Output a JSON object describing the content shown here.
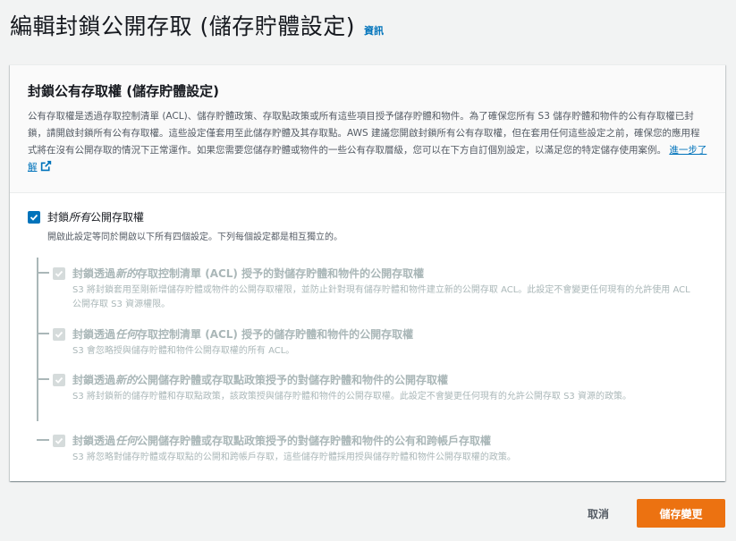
{
  "page": {
    "title": "編輯封鎖公開存取 (儲存貯體設定)",
    "info_link": "資訊"
  },
  "panel": {
    "title": "封鎖公有存取權 (儲存貯體設定)",
    "description": "公有存取權是透過存取控制清單 (ACL)、儲存貯體政策、存取點政策或所有這些項目授予儲存貯體和物件。為了確保您所有 S3 儲存貯體和物件的公有存取權已封鎖，請開啟封鎖所有公有存取權。這些設定僅套用至此儲存貯體及其存取點。AWS 建議您開啟封鎖所有公有存取權，但在套用任何這些設定之前，確保您的應用程式將在沒有公開存取的情況下正常運作。如果您需要您儲存貯體或物件的一些公有存取層級，您可以在下方自訂個別設定，以滿足您的特定儲存使用案例。",
    "learn_more": "進一步了解"
  },
  "block_all": {
    "label_prefix": "封鎖",
    "label_emph": "所有",
    "label_suffix": "公開存取權",
    "checked": true,
    "description": "開啟此設定等同於開啟以下所有四個設定。下列每個設定都是相互獨立的。"
  },
  "options": [
    {
      "label_prefix": "封鎖透過",
      "label_emph": "新的",
      "label_suffix": "存取控制清單 (ACL) 授予的對儲存貯體和物件的公開存取權",
      "description": "S3 將封鎖套用至剛新增儲存貯體或物件的公開存取權限，並防止針對現有儲存貯體和物件建立新的公開存取 ACL。此設定不會變更任何現有的允許使用 ACL 公開存取 S3 資源權限。",
      "checked": true,
      "disabled": true
    },
    {
      "label_prefix": "封鎖透過",
      "label_emph": "任何",
      "label_suffix": "存取控制清單 (ACL) 授予的儲存貯體和物件的公開存取權",
      "description": "S3 會忽略授與儲存貯體和物件公開存取權的所有 ACL。",
      "checked": true,
      "disabled": true
    },
    {
      "label_prefix": "封鎖透過",
      "label_emph": "新的",
      "label_suffix": "公開儲存貯體或存取點政策授予的對儲存貯體和物件的公開存取權",
      "description": "S3 將封鎖新的儲存貯體和存取點政策，該政策授與儲存貯體和物件的公開存取權。此設定不會變更任何現有的允許公開存取 S3 資源的政策。",
      "checked": true,
      "disabled": true
    },
    {
      "label_prefix": "封鎖透過",
      "label_emph": "任何",
      "label_suffix": "公開儲存貯體或存取點政策授予的對儲存貯體和物件的公有和跨帳戶存取權",
      "description": "S3 將忽略對儲存貯體或存取點的公開和跨帳戶存取，這些儲存貯體採用授與儲存貯體和物件公開存取權的政策。",
      "checked": true,
      "disabled": true
    }
  ],
  "footer": {
    "cancel_label": "取消",
    "save_label": "儲存變更"
  },
  "colors": {
    "accent_blue": "#0073bb",
    "primary_orange": "#ec7211",
    "disabled_gray": "#aab7b8",
    "background": "#f2f3f3"
  },
  "icons": {
    "external_link": "external-link-icon",
    "checkmark": "checkmark-icon"
  }
}
